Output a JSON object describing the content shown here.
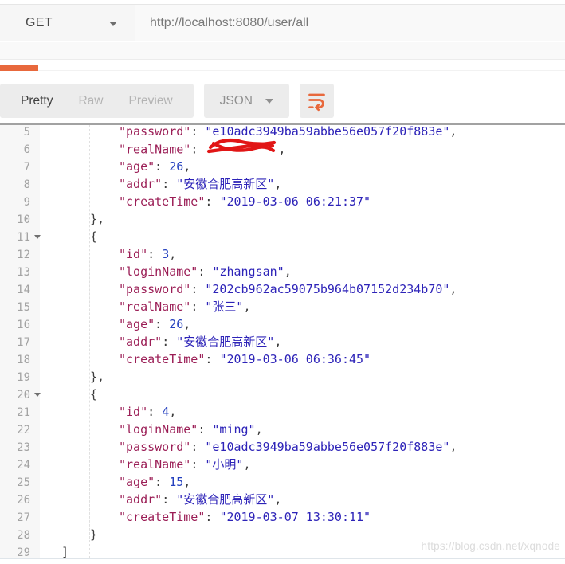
{
  "request": {
    "method": "GET",
    "url": "http://localhost:8080/user/all"
  },
  "toolbar": {
    "tabs": [
      {
        "label": "Pretty",
        "active": true
      },
      {
        "label": "Raw",
        "active": false
      },
      {
        "label": "Preview",
        "active": false
      }
    ],
    "language_select": {
      "value": "JSON"
    },
    "wrap_icon": "text-wrap-icon"
  },
  "colors": {
    "accent_orange": "#e8683c",
    "json_key": "#9b1e56",
    "json_string": "#2d23b8",
    "json_number": "#2440bf",
    "punctuation": "#3d3d3d",
    "line_number": "#a3a3a3",
    "redaction_red": "#e11616"
  },
  "watermark": "https://blog.csdn.net/xqnode",
  "code": {
    "lines": [
      {
        "n": "5",
        "indent": 2,
        "fold": false,
        "tokens": [
          [
            "k",
            "\"password\""
          ],
          [
            "p",
            ": "
          ],
          [
            "s",
            "\"e10adc3949ba59abbe56e057f20f883e\""
          ],
          [
            "p",
            ","
          ]
        ]
      },
      {
        "n": "6",
        "indent": 2,
        "fold": false,
        "tokens": [
          [
            "k",
            "\"realName\""
          ],
          [
            "p",
            ": "
          ],
          [
            "x",
            ""
          ],
          [
            "p",
            ","
          ]
        ]
      },
      {
        "n": "7",
        "indent": 2,
        "fold": false,
        "tokens": [
          [
            "k",
            "\"age\""
          ],
          [
            "p",
            ": "
          ],
          [
            "n",
            "26"
          ],
          [
            "p",
            ","
          ]
        ]
      },
      {
        "n": "8",
        "indent": 2,
        "fold": false,
        "tokens": [
          [
            "k",
            "\"addr\""
          ],
          [
            "p",
            ": "
          ],
          [
            "s",
            "\"安徽合肥高新区\""
          ],
          [
            "p",
            ","
          ]
        ]
      },
      {
        "n": "9",
        "indent": 2,
        "fold": false,
        "tokens": [
          [
            "k",
            "\"createTime\""
          ],
          [
            "p",
            ": "
          ],
          [
            "s",
            "\"2019-03-06 06:21:37\""
          ]
        ]
      },
      {
        "n": "10",
        "indent": 1,
        "fold": false,
        "tokens": [
          [
            "p",
            "},"
          ]
        ]
      },
      {
        "n": "11",
        "indent": 1,
        "fold": true,
        "tokens": [
          [
            "p",
            "{"
          ]
        ]
      },
      {
        "n": "12",
        "indent": 2,
        "fold": false,
        "tokens": [
          [
            "k",
            "\"id\""
          ],
          [
            "p",
            ": "
          ],
          [
            "n",
            "3"
          ],
          [
            "p",
            ","
          ]
        ]
      },
      {
        "n": "13",
        "indent": 2,
        "fold": false,
        "tokens": [
          [
            "k",
            "\"loginName\""
          ],
          [
            "p",
            ": "
          ],
          [
            "s",
            "\"zhangsan\""
          ],
          [
            "p",
            ","
          ]
        ]
      },
      {
        "n": "14",
        "indent": 2,
        "fold": false,
        "tokens": [
          [
            "k",
            "\"password\""
          ],
          [
            "p",
            ": "
          ],
          [
            "s",
            "\"202cb962ac59075b964b07152d234b70\""
          ],
          [
            "p",
            ","
          ]
        ]
      },
      {
        "n": "15",
        "indent": 2,
        "fold": false,
        "tokens": [
          [
            "k",
            "\"realName\""
          ],
          [
            "p",
            ": "
          ],
          [
            "s",
            "\"张三\""
          ],
          [
            "p",
            ","
          ]
        ]
      },
      {
        "n": "16",
        "indent": 2,
        "fold": false,
        "tokens": [
          [
            "k",
            "\"age\""
          ],
          [
            "p",
            ": "
          ],
          [
            "n",
            "26"
          ],
          [
            "p",
            ","
          ]
        ]
      },
      {
        "n": "17",
        "indent": 2,
        "fold": false,
        "tokens": [
          [
            "k",
            "\"addr\""
          ],
          [
            "p",
            ": "
          ],
          [
            "s",
            "\"安徽合肥高新区\""
          ],
          [
            "p",
            ","
          ]
        ]
      },
      {
        "n": "18",
        "indent": 2,
        "fold": false,
        "tokens": [
          [
            "k",
            "\"createTime\""
          ],
          [
            "p",
            ": "
          ],
          [
            "s",
            "\"2019-03-06 06:36:45\""
          ]
        ]
      },
      {
        "n": "19",
        "indent": 1,
        "fold": false,
        "tokens": [
          [
            "p",
            "},"
          ]
        ]
      },
      {
        "n": "20",
        "indent": 1,
        "fold": true,
        "tokens": [
          [
            "p",
            "{"
          ]
        ]
      },
      {
        "n": "21",
        "indent": 2,
        "fold": false,
        "tokens": [
          [
            "k",
            "\"id\""
          ],
          [
            "p",
            ": "
          ],
          [
            "n",
            "4"
          ],
          [
            "p",
            ","
          ]
        ]
      },
      {
        "n": "22",
        "indent": 2,
        "fold": false,
        "tokens": [
          [
            "k",
            "\"loginName\""
          ],
          [
            "p",
            ": "
          ],
          [
            "s",
            "\"ming\""
          ],
          [
            "p",
            ","
          ]
        ]
      },
      {
        "n": "23",
        "indent": 2,
        "fold": false,
        "tokens": [
          [
            "k",
            "\"password\""
          ],
          [
            "p",
            ": "
          ],
          [
            "s",
            "\"e10adc3949ba59abbe56e057f20f883e\""
          ],
          [
            "p",
            ","
          ]
        ]
      },
      {
        "n": "24",
        "indent": 2,
        "fold": false,
        "tokens": [
          [
            "k",
            "\"realName\""
          ],
          [
            "p",
            ": "
          ],
          [
            "s",
            "\"小明\""
          ],
          [
            "p",
            ","
          ]
        ]
      },
      {
        "n": "25",
        "indent": 2,
        "fold": false,
        "tokens": [
          [
            "k",
            "\"age\""
          ],
          [
            "p",
            ": "
          ],
          [
            "n",
            "15"
          ],
          [
            "p",
            ","
          ]
        ]
      },
      {
        "n": "26",
        "indent": 2,
        "fold": false,
        "tokens": [
          [
            "k",
            "\"addr\""
          ],
          [
            "p",
            ": "
          ],
          [
            "s",
            "\"安徽合肥高新区\""
          ],
          [
            "p",
            ","
          ]
        ]
      },
      {
        "n": "27",
        "indent": 2,
        "fold": false,
        "tokens": [
          [
            "k",
            "\"createTime\""
          ],
          [
            "p",
            ": "
          ],
          [
            "s",
            "\"2019-03-07 13:30:11\""
          ]
        ]
      },
      {
        "n": "28",
        "indent": 1,
        "fold": false,
        "tokens": [
          [
            "p",
            "}"
          ]
        ]
      },
      {
        "n": "29",
        "indent": 0,
        "fold": false,
        "tokens": [
          [
            "p",
            "]"
          ]
        ]
      }
    ]
  }
}
